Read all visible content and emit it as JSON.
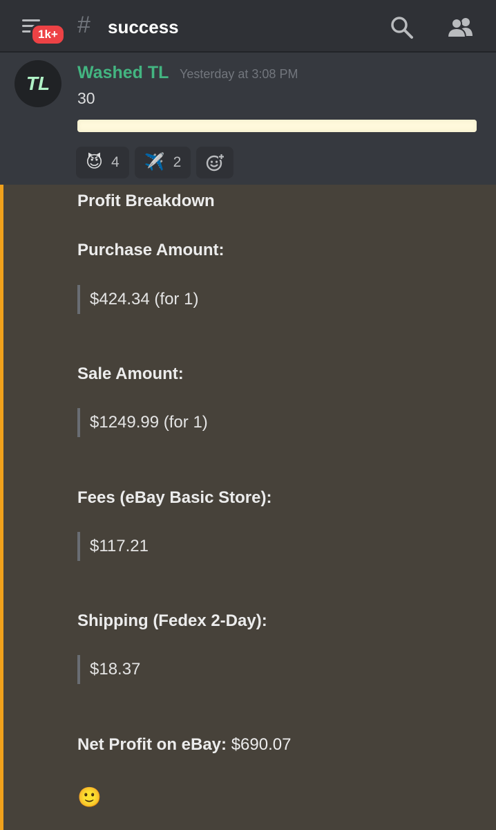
{
  "header": {
    "badge": "1k+",
    "hash": "#",
    "channel": "success"
  },
  "message": {
    "avatar_text": "TL",
    "author": "Washed TL",
    "timestamp": "Yesterday at 3:08 PM",
    "text": "30",
    "reactions": [
      {
        "emoji": "😈",
        "count": "4"
      },
      {
        "emoji": "✈️",
        "count": "2"
      }
    ]
  },
  "embed": {
    "title": "Profit Breakdown",
    "fields": [
      {
        "label": "Purchase Amount:",
        "value": "$424.34 (for 1)"
      },
      {
        "label": "Sale Amount:",
        "value": "$1249.99 (for 1)"
      },
      {
        "label": "Fees (eBay Basic Store):",
        "value": "$117.21"
      },
      {
        "label": "Shipping (Fedex 2-Day):",
        "value": "$18.37"
      }
    ],
    "net_label": "Net Profit on eBay:",
    "net_value": "$690.07",
    "emoji": "🙂"
  },
  "colors": {
    "author": "#43b581",
    "embed_accent": "#f0a11c",
    "badge": "#ed4245"
  },
  "icons": [
    "hamburger-menu-icon",
    "search-icon",
    "members-icon",
    "add-reaction-icon"
  ]
}
